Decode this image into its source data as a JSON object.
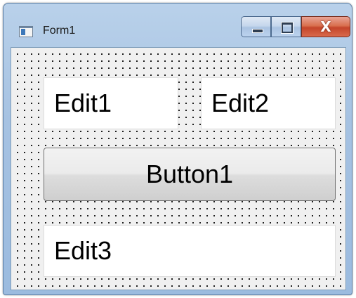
{
  "window": {
    "title": "Form1",
    "icon": "form-icon",
    "close_glyph": "X"
  },
  "form": {
    "edit1_text": "Edit1",
    "edit2_text": "Edit2",
    "button1_label": "Button1",
    "edit3_text": "Edit3"
  },
  "colors": {
    "titlebar": "#a6c2e2",
    "close_button": "#c4452a",
    "client_background": "#f0f0f0"
  }
}
